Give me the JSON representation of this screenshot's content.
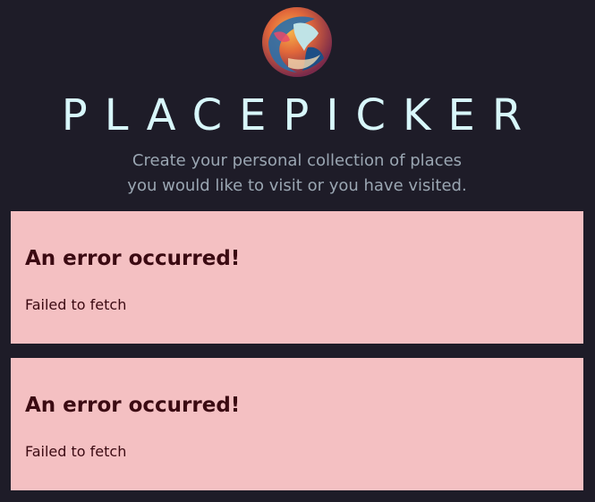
{
  "header": {
    "logo_icon": "globe-logo-icon",
    "title": "PLACEPICKER",
    "subtitle": "Create your personal collection of places you would like to visit or you have visited."
  },
  "errors": [
    {
      "title": "An error occurred!",
      "message": "Failed to fetch"
    },
    {
      "title": "An error occurred!",
      "message": "Failed to fetch"
    }
  ],
  "colors": {
    "background": "#1e1c28",
    "title": "#d8f7fb",
    "subtitle": "#9aa6b2",
    "error_bg": "#f4c0c2",
    "error_text": "#3b0a12"
  }
}
